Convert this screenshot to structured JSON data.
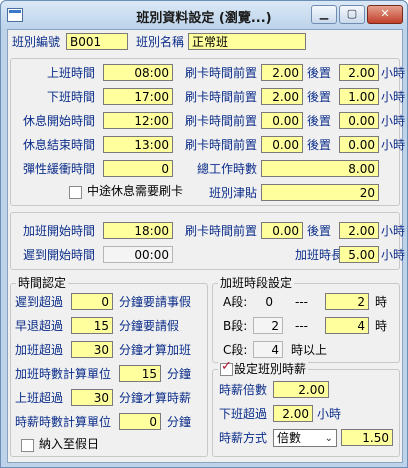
{
  "window": {
    "title": "班別資料設定 (瀏覽...)"
  },
  "header": {
    "code_label": "班別編號",
    "code_value": "B001",
    "name_label": "班別名稱",
    "name_value": "正常班"
  },
  "times": {
    "work_start_label": "上班時間",
    "work_start": "08:00",
    "work_end_label": "下班時間",
    "work_end": "17:00",
    "rest_start_label": "休息開始時間",
    "rest_start": "12:00",
    "rest_end_label": "休息結束時間",
    "rest_end": "13:00",
    "buffer_label": "彈性緩衝時間",
    "buffer": "0",
    "break_card_label": "中途休息需要刷卡",
    "card_before_label": "刷卡時間前置",
    "after_label": "後置",
    "hour_unit": "小時",
    "rows": [
      {
        "before": "2.00",
        "after": "2.00"
      },
      {
        "before": "2.00",
        "after": "1.00"
      },
      {
        "before": "0.00",
        "after": "0.00"
      },
      {
        "before": "0.00",
        "after": "0.00"
      }
    ],
    "total_hours_label": "總工作時數",
    "total_hours": "8.00",
    "allowance_label": "班別津貼",
    "allowance": "20"
  },
  "overtime": {
    "start_label": "加班開始時間",
    "start": "18:00",
    "card_before_label": "刷卡時間前置",
    "before": "0.00",
    "after_label": "後置",
    "after": "2.00",
    "hour_unit": "小時",
    "late_start_label": "遲到開始時間",
    "late_start": "00:00",
    "length_label": "加班時長",
    "length": "5.00"
  },
  "time_rules": {
    "legend": "時間認定",
    "rows": [
      {
        "label": "遲到超過",
        "value": "0",
        "suffix": "分鐘要請事假"
      },
      {
        "label": "早退超過",
        "value": "15",
        "suffix": "分鐘要請假"
      },
      {
        "label": "加班超過",
        "value": "30",
        "suffix": "分鐘才算加班"
      },
      {
        "label": "加班時數計算單位",
        "value": "15",
        "suffix": "分鐘"
      },
      {
        "label": "上班超過",
        "value": "30",
        "suffix": "分鐘才算時薪"
      },
      {
        "label": "時薪時數計算單位",
        "value": "0",
        "suffix": "分鐘"
      }
    ],
    "holiday_label": "納入至假日"
  },
  "segments": {
    "legend": "加班時段設定",
    "rows": [
      {
        "label": "A段:",
        "from": "0",
        "sep": "---",
        "to": "2",
        "unit": "時"
      },
      {
        "label": "B段:",
        "from": "2",
        "sep": "---",
        "to": "4",
        "unit": "時"
      },
      {
        "label": "C段:",
        "from": "4",
        "unit": "時以上"
      }
    ]
  },
  "hourly": {
    "legend": "設定班別時薪",
    "checked": true,
    "rate_label": "時薪倍數",
    "rate": "2.00",
    "after_work_label": "下班超過",
    "after_work": "2.00",
    "after_unit": "小時",
    "mode_label": "時薪方式",
    "mode_value": "倍數",
    "mode_amount": "1.50"
  },
  "colors": {
    "field_bg": "#ffff9e",
    "frame": "#bcd3ea",
    "label_blue": "#0b2d8a",
    "close": "#c0402a"
  }
}
